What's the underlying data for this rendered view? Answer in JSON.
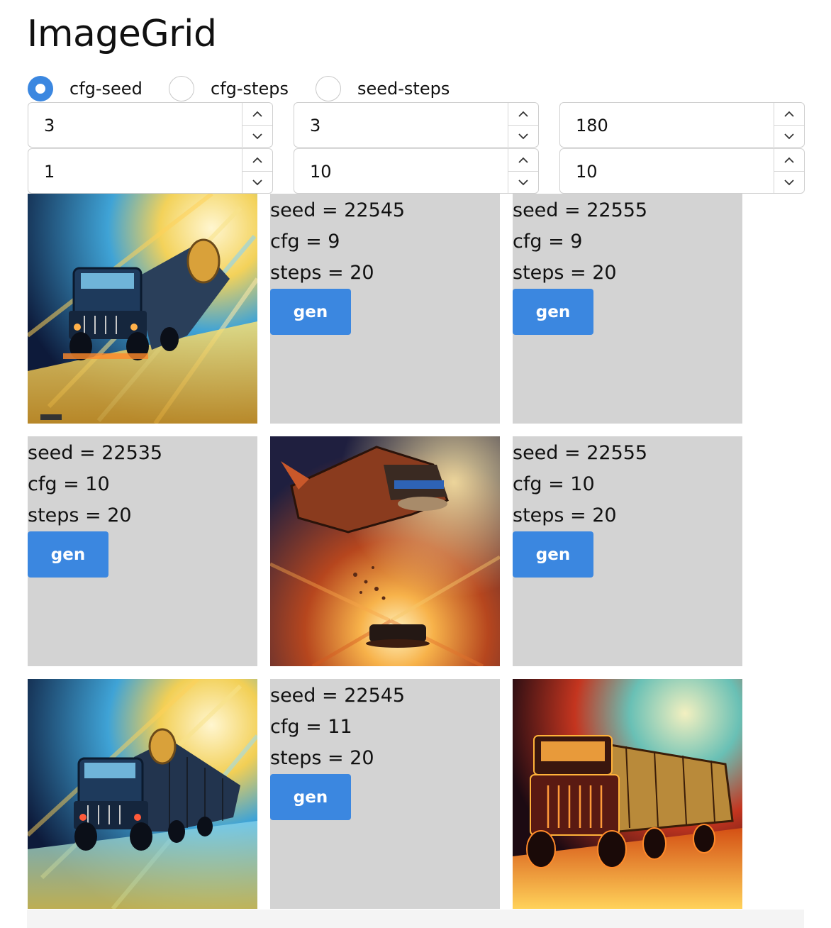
{
  "app": {
    "title": "ImageGrid"
  },
  "modes": [
    {
      "label": "cfg-seed",
      "selected": true
    },
    {
      "label": "cfg-steps",
      "selected": false
    },
    {
      "label": "seed-steps",
      "selected": false
    }
  ],
  "inputs": {
    "row1": [
      "3",
      "3",
      "180"
    ],
    "row2": [
      "1",
      "10",
      "10"
    ]
  },
  "button_label": "gen",
  "grid": [
    [
      {
        "kind": "image",
        "image": "blue-yellow-speed-truck"
      },
      {
        "kind": "params",
        "seed": "seed = 22545",
        "cfg": "cfg = 9",
        "steps": "steps = 20"
      },
      {
        "kind": "params",
        "seed": "seed = 22555",
        "cfg": "cfg = 9",
        "steps": "steps = 20"
      }
    ],
    [
      {
        "kind": "params",
        "seed": "seed = 22535",
        "cfg": "cfg = 10",
        "steps": "steps = 20"
      },
      {
        "kind": "image",
        "image": "flying-truck-sunset"
      },
      {
        "kind": "params",
        "seed": "seed = 22555",
        "cfg": "cfg = 10",
        "steps": "steps = 20"
      }
    ],
    [
      {
        "kind": "image",
        "image": "blue-yellow-speed-truck-long"
      },
      {
        "kind": "params",
        "seed": "seed = 22545",
        "cfg": "cfg = 11",
        "steps": "steps = 20"
      },
      {
        "kind": "image",
        "image": "orange-truck-night-sky"
      }
    ]
  ],
  "colors": {
    "accent": "#3b87e0",
    "cell_bg": "#d3d3d3"
  }
}
